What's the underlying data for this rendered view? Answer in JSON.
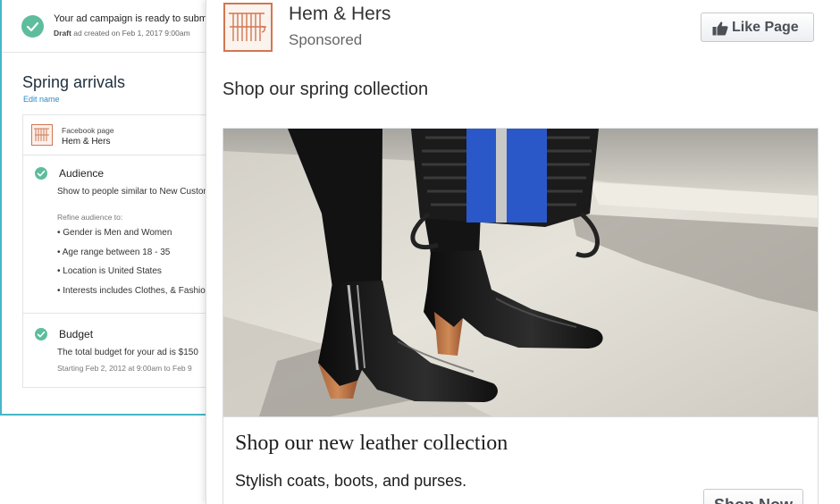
{
  "banner": {
    "title": "Your ad campaign is ready to submit",
    "status": "Draft",
    "subtitle": "ad created on Feb 1, 2017 9:00am"
  },
  "campaign": {
    "title": "Spring arrivals",
    "edit_label": "Edit name"
  },
  "facebook_page": {
    "label": "Facebook page",
    "name": "Hem & Hers"
  },
  "audience": {
    "title": "Audience",
    "description": "Show to people similar to New Customers",
    "refine_label": "Refine audience to:",
    "items": [
      "• Gender is Men and Women",
      "• Age range between 18 - 35",
      "• Location is United States",
      "• Interests includes Clothes, & Fashion"
    ]
  },
  "budget": {
    "title": "Budget",
    "description": "The total budget for your ad is $150",
    "schedule": "Starting Feb 2, 2012 at 9:00am to Feb 9"
  },
  "ad": {
    "brand_name": "Hem & Hers",
    "sponsored_label": "Sponsored",
    "like_button": "Like Page",
    "primary_text": "Shop our spring collection",
    "headline": "Shop our new leather collection",
    "description": "Stylish coats, boots, and purses.",
    "cta_button": "Shop Now"
  },
  "icons": {
    "check": "check-circle-icon",
    "like": "thumbs-up-icon",
    "logo": "hem-hers-logo"
  },
  "colors": {
    "accent": "#47b6c7",
    "success": "#5dbd9d",
    "link": "#2a8bc5",
    "brand": "#d27652"
  }
}
